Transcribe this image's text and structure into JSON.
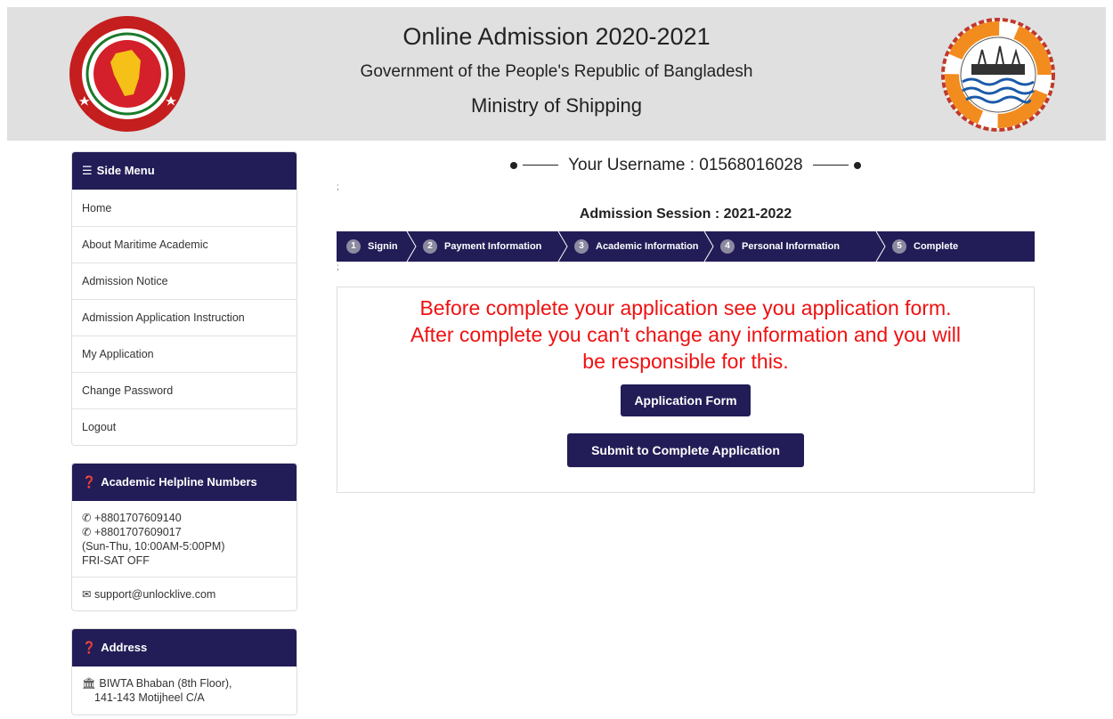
{
  "header": {
    "title": "Online Admission 2020-2021",
    "subtitle": "Government of the People's Republic of Bangladesh",
    "ministry": "Ministry of Shipping",
    "colors": {
      "background": "#e0e0e0",
      "accent": "#221d57"
    }
  },
  "sidebar": {
    "menu_title": "Side Menu",
    "menu_items": [
      {
        "label": "Home"
      },
      {
        "label": "About Maritime Academic"
      },
      {
        "label": "Admission Notice"
      },
      {
        "label": "Admission Application Instruction"
      },
      {
        "label": "My Application"
      },
      {
        "label": "Change Password"
      },
      {
        "label": "Logout"
      }
    ],
    "helpline": {
      "title": "Academic Helpline Numbers",
      "phones": [
        "+8801707609140",
        "+8801707609017"
      ],
      "hours": "(Sun-Thu, 10:00AM-5:00PM)",
      "off_days": "FRI-SAT OFF",
      "email": "support@unlocklive.com"
    },
    "address": {
      "title": "Address",
      "line1": "BIWTA Bhaban (8th Floor),",
      "line2": "141-143 Motijheel C/A"
    }
  },
  "main": {
    "username_label": "Your Username : 01568016028",
    "semicolon": ";",
    "session_label": "Admission Session : 2021-2022",
    "steps": [
      {
        "num": "1",
        "label": "Signin"
      },
      {
        "num": "2",
        "label": "Payment Information"
      },
      {
        "num": "3",
        "label": "Academic Information"
      },
      {
        "num": "4",
        "label": "Personal Information"
      },
      {
        "num": "5",
        "label": "Complete"
      }
    ],
    "warning_line1": "Before complete your application see you application form.",
    "warning_line2": "After complete you can't change any information and you will",
    "warning_line3": "be responsible for this.",
    "application_form_button": "Application Form",
    "submit_button": "Submit to Complete Application",
    "warning_color": "#ee1111"
  },
  "icons": {
    "menu": "hamburger-icon",
    "help": "question-circle-icon",
    "phone": "phone-icon",
    "email": "envelope-icon",
    "address": "bank-icon"
  }
}
